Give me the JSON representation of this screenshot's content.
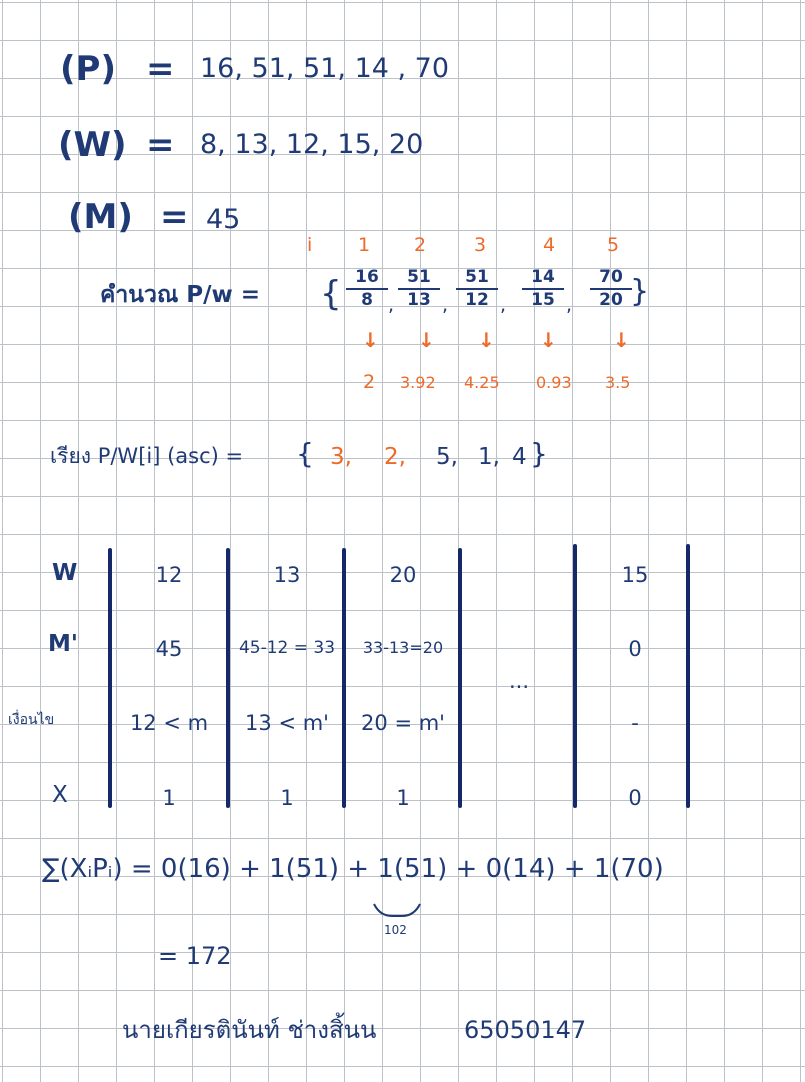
{
  "given": {
    "p": {
      "label": "(P)",
      "eq": "=",
      "values": "16,  51,  51,  14 ,  70"
    },
    "w": {
      "label": "(W)",
      "eq": "=",
      "values": "8,  13,  12,  15,  20"
    },
    "m": {
      "label": "(M)",
      "eq": "=",
      "value": "45"
    }
  },
  "ratio": {
    "index_label": "i",
    "indices": [
      "1",
      "2",
      "3",
      "4",
      "5"
    ],
    "title": "คำนวณ  P/w  =",
    "open_brace": "{",
    "close_brace": "}",
    "fractions": [
      {
        "num": "16",
        "den": "8"
      },
      {
        "num": "51",
        "den": "13"
      },
      {
        "num": "51",
        "den": "12"
      },
      {
        "num": "14",
        "den": "15"
      },
      {
        "num": "70",
        "den": "20"
      }
    ],
    "results": [
      "2",
      "3.92",
      "4.25",
      "0.93",
      "3.5"
    ]
  },
  "sort": {
    "label": "เรียง  P/W[i]  (asc) =",
    "open_brace": "{",
    "order": [
      "3,",
      "2,",
      "5,",
      "1,",
      "4"
    ],
    "close_brace": "}"
  },
  "table": {
    "row_labels": [
      "W",
      "M'",
      "เงื่อนไข",
      "X"
    ],
    "columns": [
      {
        "w": "12",
        "m": "45",
        "cond": "12 < m",
        "x": "1"
      },
      {
        "w": "13",
        "m": "45-12 = 33",
        "cond": "13 < m'",
        "x": "1"
      },
      {
        "w": "20",
        "m": "33-13=20",
        "cond": "20 = m'",
        "x": "1"
      },
      {
        "w": "",
        "m": "",
        "cond": "...",
        "x": ""
      },
      {
        "w": "15",
        "m": "0",
        "cond": "-",
        "x": "0"
      }
    ]
  },
  "sum": {
    "expr": "∑(XᵢPᵢ)  =   0(16)  +   1(51)  +  1(51)  +  0(14)  +  1(70)",
    "sub_note": "102",
    "result": "=  172"
  },
  "signature": {
    "name": "นายเกียรตินันท์  ช่างสิ้นน",
    "student_id": "65050147"
  }
}
